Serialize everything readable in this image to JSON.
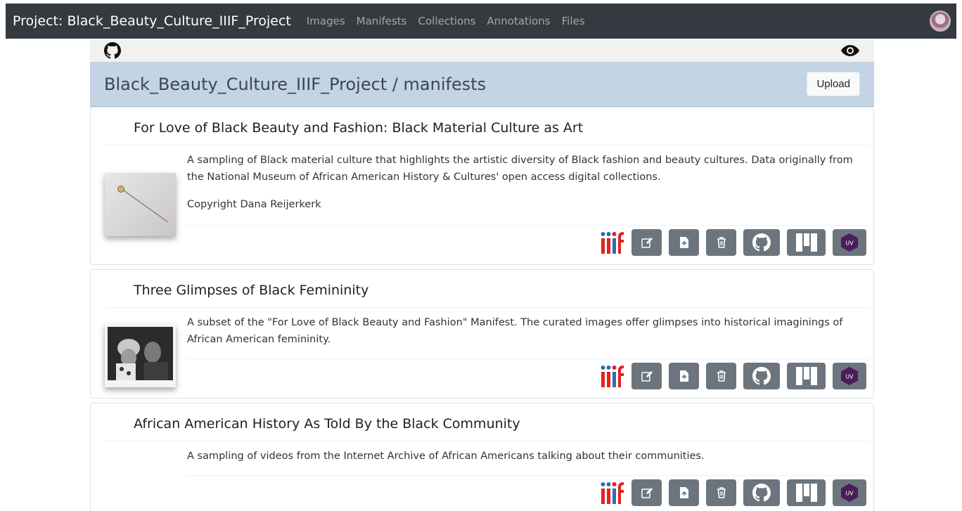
{
  "navbar": {
    "brand": "Project: Black_Beauty_Culture_IIIF_Project",
    "links": [
      "Images",
      "Manifests",
      "Collections",
      "Annotations",
      "Files"
    ]
  },
  "header": {
    "title": "Black_Beauty_Culture_IIIF_Project / manifests",
    "upload_label": "Upload"
  },
  "manifests": [
    {
      "title": "For Love of Black Beauty and Fashion: Black Material Culture as Art",
      "description": "A sampling of Black material culture that highlights the artistic diversity of Black fashion and beauty cultures. Data originally from the National Museum of African American History & Cultures' open access digital collections.",
      "copyright": "Copyright Dana Reijerkerk"
    },
    {
      "title": "Three Glimpses of Black Femininity",
      "description": "A subset of the \"For Love of Black Beauty and Fashion\" Manifest. The curated images offer glimpses into historical imaginings of African American femininity."
    },
    {
      "title": "African American History As Told By the Black Community",
      "description": "A sampling of videos from the Internet Archive of African Americans talking about their communities."
    }
  ],
  "actions": {
    "uv_label": "UV",
    "icons": [
      "iiif-icon",
      "edit-icon",
      "file-upload-icon",
      "trash-icon",
      "github-icon",
      "mirador-icon",
      "uv-icon"
    ]
  },
  "colors": {
    "navbar": "#343a40",
    "title_bar": "#c3d4e4",
    "action_button": "#6c757d",
    "iiif_red": "#e1221f",
    "iiif_blue": "#2870b6",
    "uv_purple": "#4b1c5a"
  }
}
